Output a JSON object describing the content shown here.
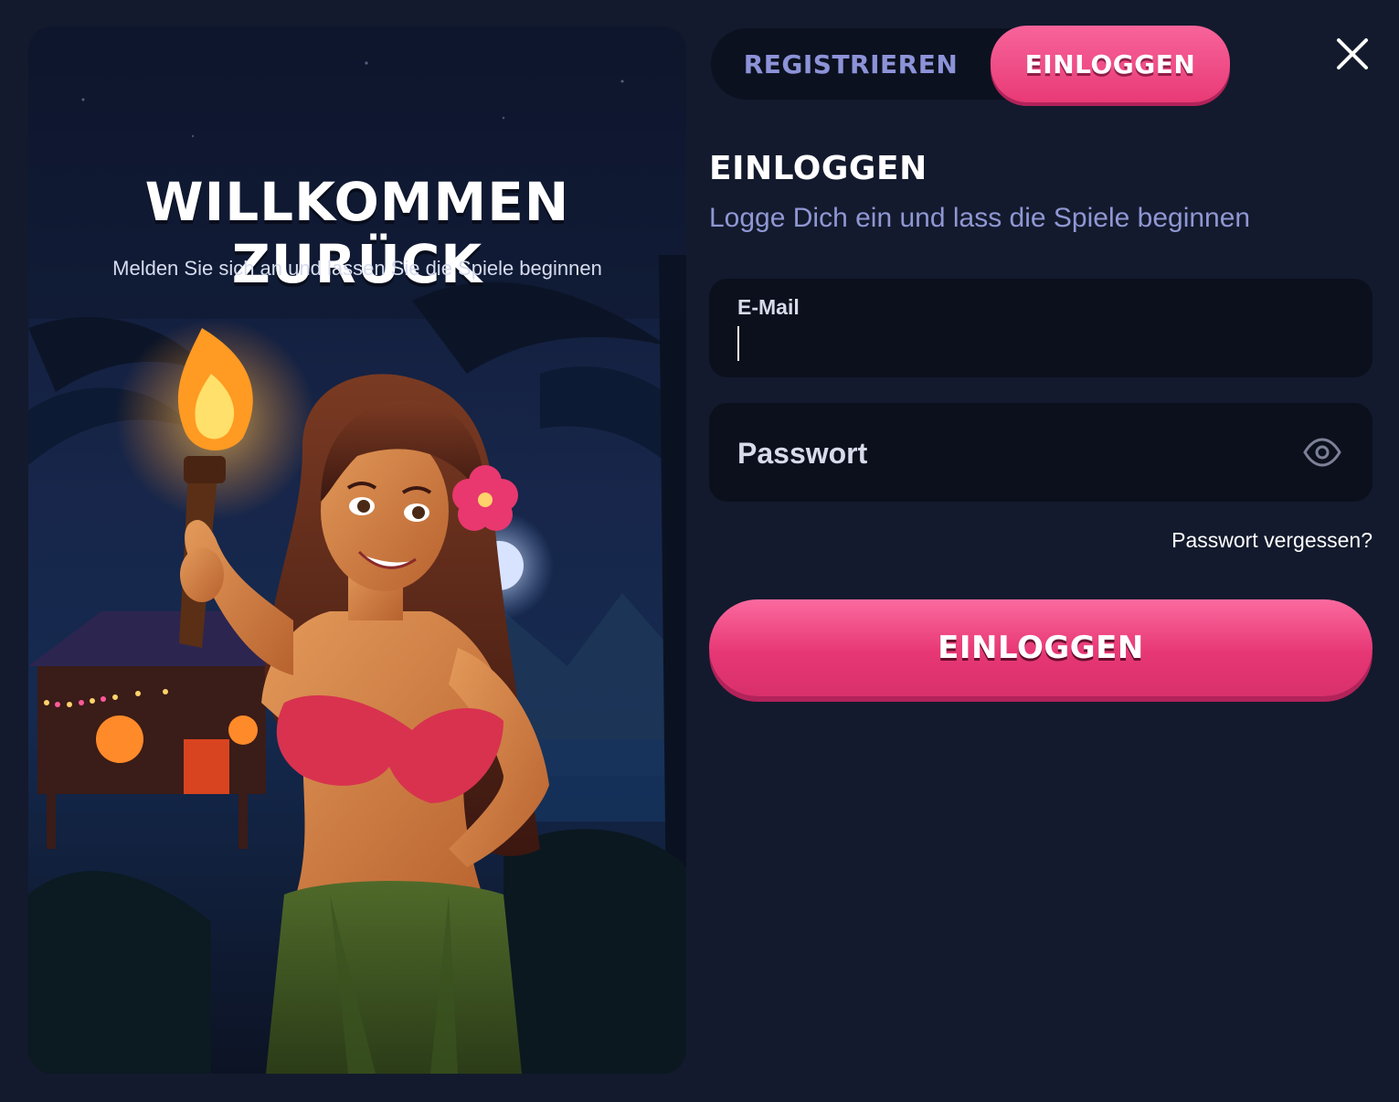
{
  "tabs": {
    "register_label": "REGISTRIEREN",
    "login_label": "EINLOGGEN",
    "active": "login"
  },
  "hero": {
    "title": "WILLKOMMEN ZURÜCK",
    "subtitle": "Melden Sie sich an und lassen Sie die Spiele beginnen",
    "illustration_icon": "tiki-girl-with-torch-illustration"
  },
  "form": {
    "title": "EINLOGGEN",
    "subtitle": "Logge Dich ein und lass die Spiele beginnen",
    "email": {
      "label": "E-Mail",
      "value": ""
    },
    "password": {
      "placeholder": "Passwort",
      "value": "",
      "toggle_icon": "eye-icon"
    },
    "forgot_label": "Passwort vergessen?",
    "submit_label": "EINLOGGEN"
  },
  "close_icon": "close-icon",
  "colors": {
    "background": "#131a2d",
    "input_background": "#0c101d",
    "accent_pink": "#e83a76",
    "muted_lavender": "#8f97d4"
  }
}
